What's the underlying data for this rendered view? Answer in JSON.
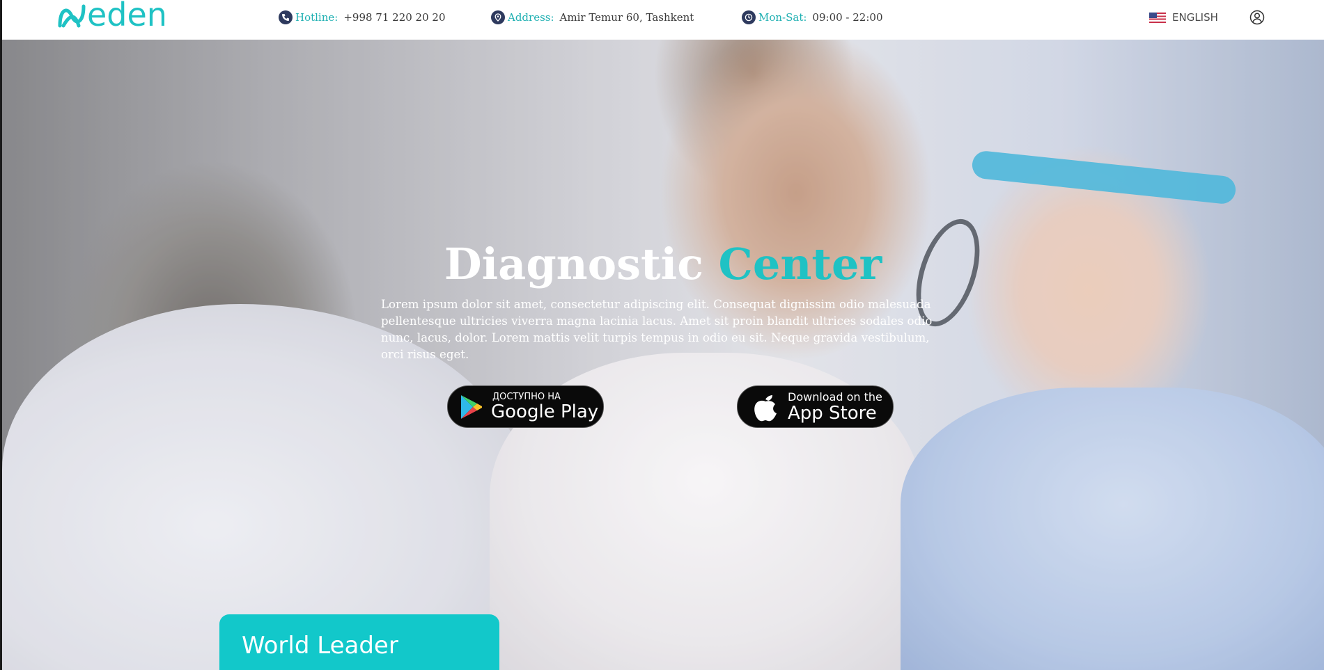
{
  "brand": {
    "logo_text": "eden",
    "accent_color": "#1fc2c4"
  },
  "topbar": {
    "hotline": {
      "label": "Hotline:",
      "value": "+998 71 220 20 20",
      "icon": "phone-icon"
    },
    "address": {
      "label": "Address:",
      "value": "Amir Temur 60, Tashkent",
      "icon": "location-pin-icon"
    },
    "hours": {
      "label": "Mon-Sat:",
      "value": "09:00 - 22:00",
      "icon": "clock-icon"
    },
    "language": {
      "label": "ENGLISH",
      "icon": "us-flag-icon"
    },
    "user": {
      "icon": "user-icon"
    }
  },
  "hero": {
    "title_main": "Diagnostic",
    "title_accent": "Center",
    "text": "Lorem ipsum dolor sit amet, consectetur adipiscing elit. Consequat dignissim odio malesuada pellentesque ultricies viverra magna lacinia lacus. Amet sit proin blandit ultrices sodales odio nunc, lacus, dolor. Lorem mattis velit turpis tempus in odio eu sit. Neque gravida vestibulum, orci risus eget.",
    "google_play": {
      "small": "ДОСТУПНО НА",
      "big": "Google Play"
    },
    "app_store": {
      "small": "Download on the",
      "big": "App Store"
    }
  },
  "card": {
    "title": "World Leader"
  }
}
